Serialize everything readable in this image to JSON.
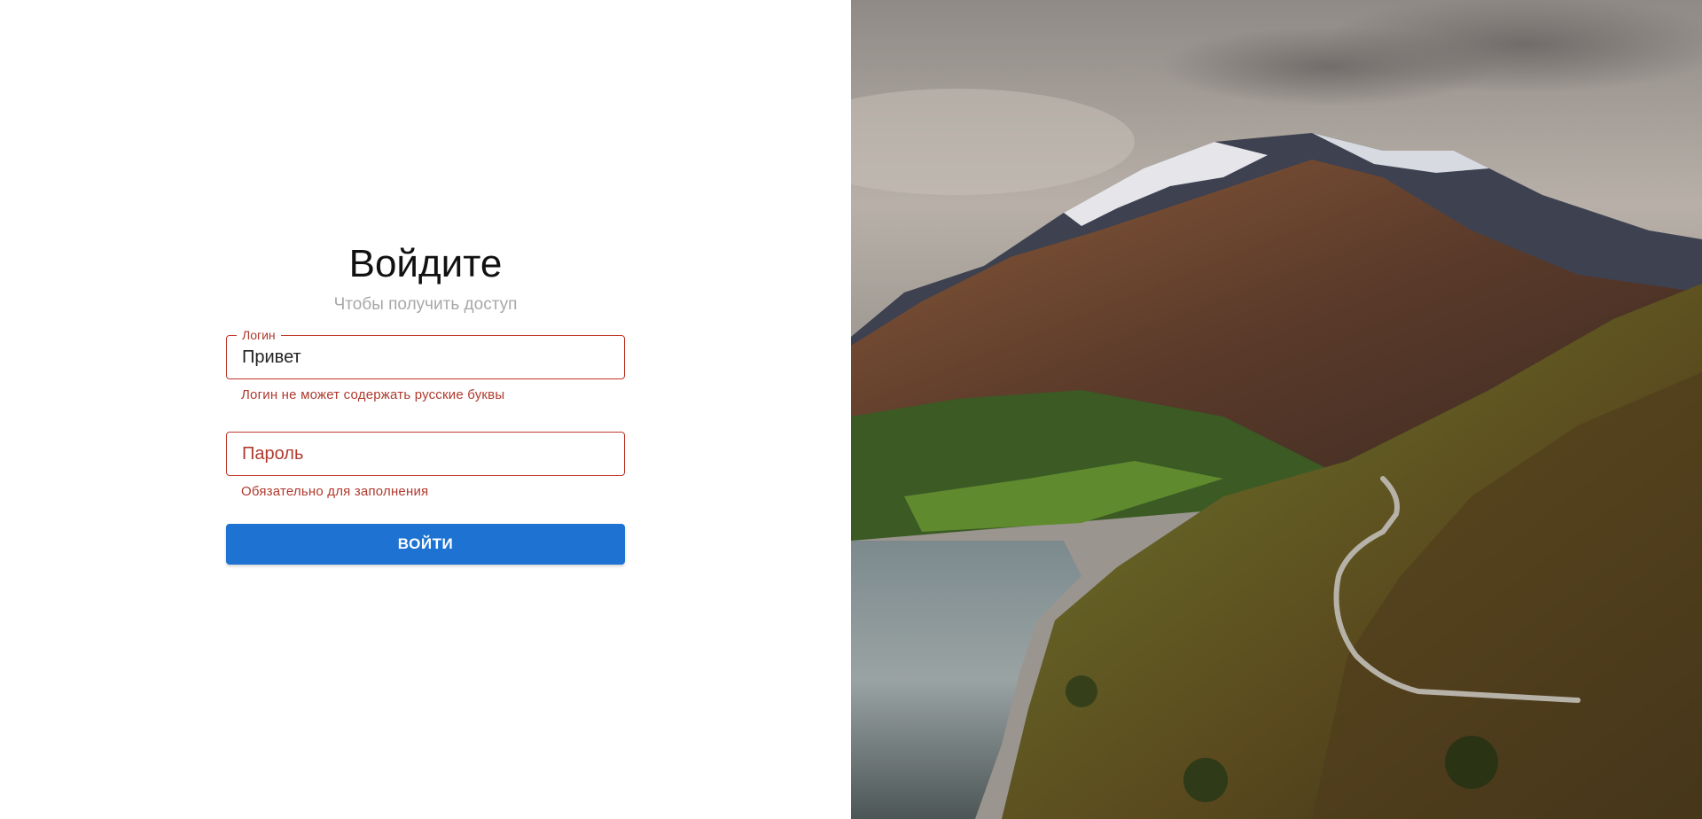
{
  "login_form": {
    "title": "Войдите",
    "subtitle": "Чтобы получить доступ",
    "login_field": {
      "label": "Логин",
      "value": "Привет",
      "error": "Логин не может содержать русские буквы"
    },
    "password_field": {
      "placeholder": "Пароль",
      "value": "",
      "error": "Обязательно для заполнения"
    },
    "submit_label": "ВОЙТИ"
  },
  "colors": {
    "accent": "#1e73d2",
    "error": "#b03a2e",
    "muted_text": "#a8a8a8"
  },
  "hero_image": {
    "content": "mountain-lake-landscape"
  }
}
